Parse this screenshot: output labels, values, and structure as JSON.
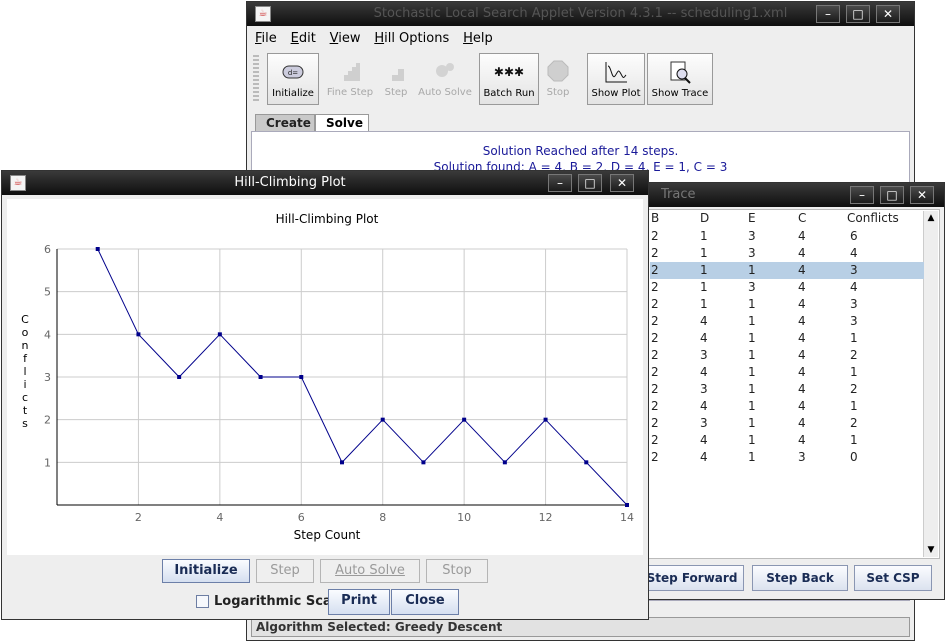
{
  "main_window": {
    "title": "Stochastic Local Search Applet Version 4.3.1 -- scheduling1.xml",
    "menu": [
      "File",
      "Edit",
      "View",
      "Hill Options",
      "Help"
    ],
    "toolbar": [
      {
        "label": "Initialize",
        "enabled": true,
        "icon": "initialize-icon"
      },
      {
        "label": "Fine Step",
        "enabled": false,
        "icon": "fine-step-icon"
      },
      {
        "label": "Step",
        "enabled": false,
        "icon": "step-icon"
      },
      {
        "label": "Auto Solve",
        "enabled": false,
        "icon": "auto-solve-icon"
      },
      {
        "label": "Batch Run",
        "enabled": true,
        "icon": "batch-run-icon"
      },
      {
        "label": "Stop",
        "enabled": false,
        "icon": "stop-icon"
      },
      {
        "label": "Show Plot",
        "enabled": true,
        "icon": "show-plot-icon"
      },
      {
        "label": "Show Trace",
        "enabled": true,
        "icon": "show-trace-icon"
      }
    ],
    "tabs": [
      "Create",
      "Solve"
    ],
    "active_tab": "Solve",
    "status_line1": "Solution Reached after 14 steps.",
    "status_line2": "Solution found:  A = 4, B = 2, D = 4, E = 1, C = 3",
    "algorithm_status": "Algorithm Selected:  Greedy Descent"
  },
  "trace_window": {
    "title": "Trace",
    "columns": [
      "B",
      "D",
      "E",
      "C",
      "Conflicts"
    ],
    "rows": [
      [
        "2",
        "1",
        "3",
        "4",
        "6"
      ],
      [
        "2",
        "1",
        "3",
        "4",
        "4"
      ],
      [
        "2",
        "1",
        "1",
        "4",
        "3"
      ],
      [
        "2",
        "1",
        "3",
        "4",
        "4"
      ],
      [
        "2",
        "1",
        "1",
        "4",
        "3"
      ],
      [
        "2",
        "4",
        "1",
        "4",
        "3"
      ],
      [
        "2",
        "4",
        "1",
        "4",
        "1"
      ],
      [
        "2",
        "3",
        "1",
        "4",
        "2"
      ],
      [
        "2",
        "4",
        "1",
        "4",
        "1"
      ],
      [
        "2",
        "3",
        "1",
        "4",
        "2"
      ],
      [
        "2",
        "4",
        "1",
        "4",
        "1"
      ],
      [
        "2",
        "3",
        "1",
        "4",
        "2"
      ],
      [
        "2",
        "4",
        "1",
        "4",
        "1"
      ],
      [
        "2",
        "4",
        "1",
        "3",
        "0"
      ]
    ],
    "selected_row": 2,
    "buttons": [
      "Step Forward",
      "Step Back",
      "Set CSP"
    ]
  },
  "plot_window": {
    "title": "Hill-Climbing Plot",
    "buttons": [
      {
        "label": "Initialize",
        "enabled": true
      },
      {
        "label": "Step",
        "enabled": false
      },
      {
        "label": "Auto Solve",
        "enabled": false
      },
      {
        "label": "Stop",
        "enabled": false
      }
    ],
    "log_scale_label": "Logarithmic Scale",
    "log_scale_checked": false,
    "print_label": "Print",
    "close_label": "Close"
  },
  "chart_data": {
    "type": "line",
    "title": "Hill-Climbing Plot",
    "xlabel": "Step Count",
    "ylabel": "Conflicts",
    "x": [
      1,
      2,
      3,
      4,
      5,
      6,
      7,
      8,
      9,
      10,
      11,
      12,
      13,
      14
    ],
    "series": [
      {
        "values": [
          6,
          4,
          3,
          4,
          3,
          3,
          1,
          2,
          1,
          2,
          1,
          2,
          1,
          0
        ]
      }
    ],
    "xlim": [
      0,
      14
    ],
    "ylim": [
      0,
      6
    ],
    "x_ticks": [
      2,
      4,
      6,
      8,
      10,
      12,
      14
    ],
    "y_ticks": [
      1,
      2,
      3,
      4,
      5,
      6
    ],
    "grid": true,
    "line_color": "#00008b"
  }
}
